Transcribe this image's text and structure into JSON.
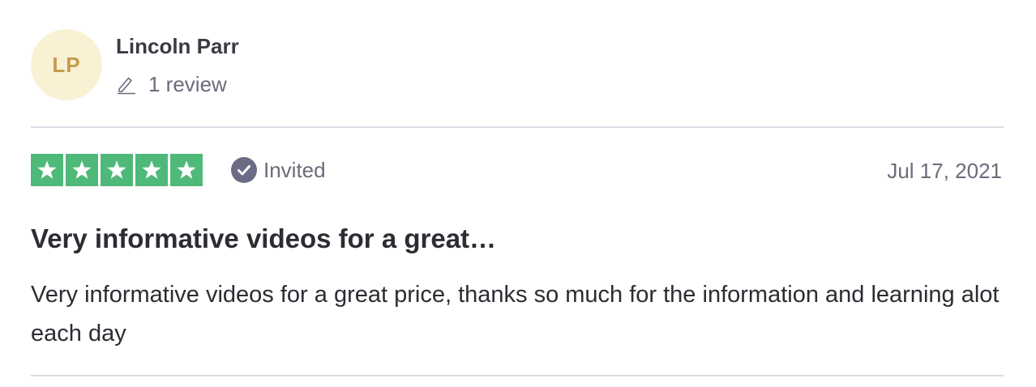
{
  "reviewer": {
    "initials": "LP",
    "name": "Lincoln Parr",
    "review_count": "1 review",
    "avatar_bg": "#f8f1d4",
    "avatar_fg": "#c59a4e",
    "review_count_icon": "pencil-icon"
  },
  "review": {
    "rating": 5,
    "rating_max": 5,
    "star_color": "#4fb97a",
    "invited_label": "Invited",
    "invited_icon": "check-circle-icon",
    "date": "Jul 17, 2021",
    "title": "Very informative videos for a great…",
    "body": "Very informative videos for a great price, thanks so much for the information and learning alot each day"
  }
}
